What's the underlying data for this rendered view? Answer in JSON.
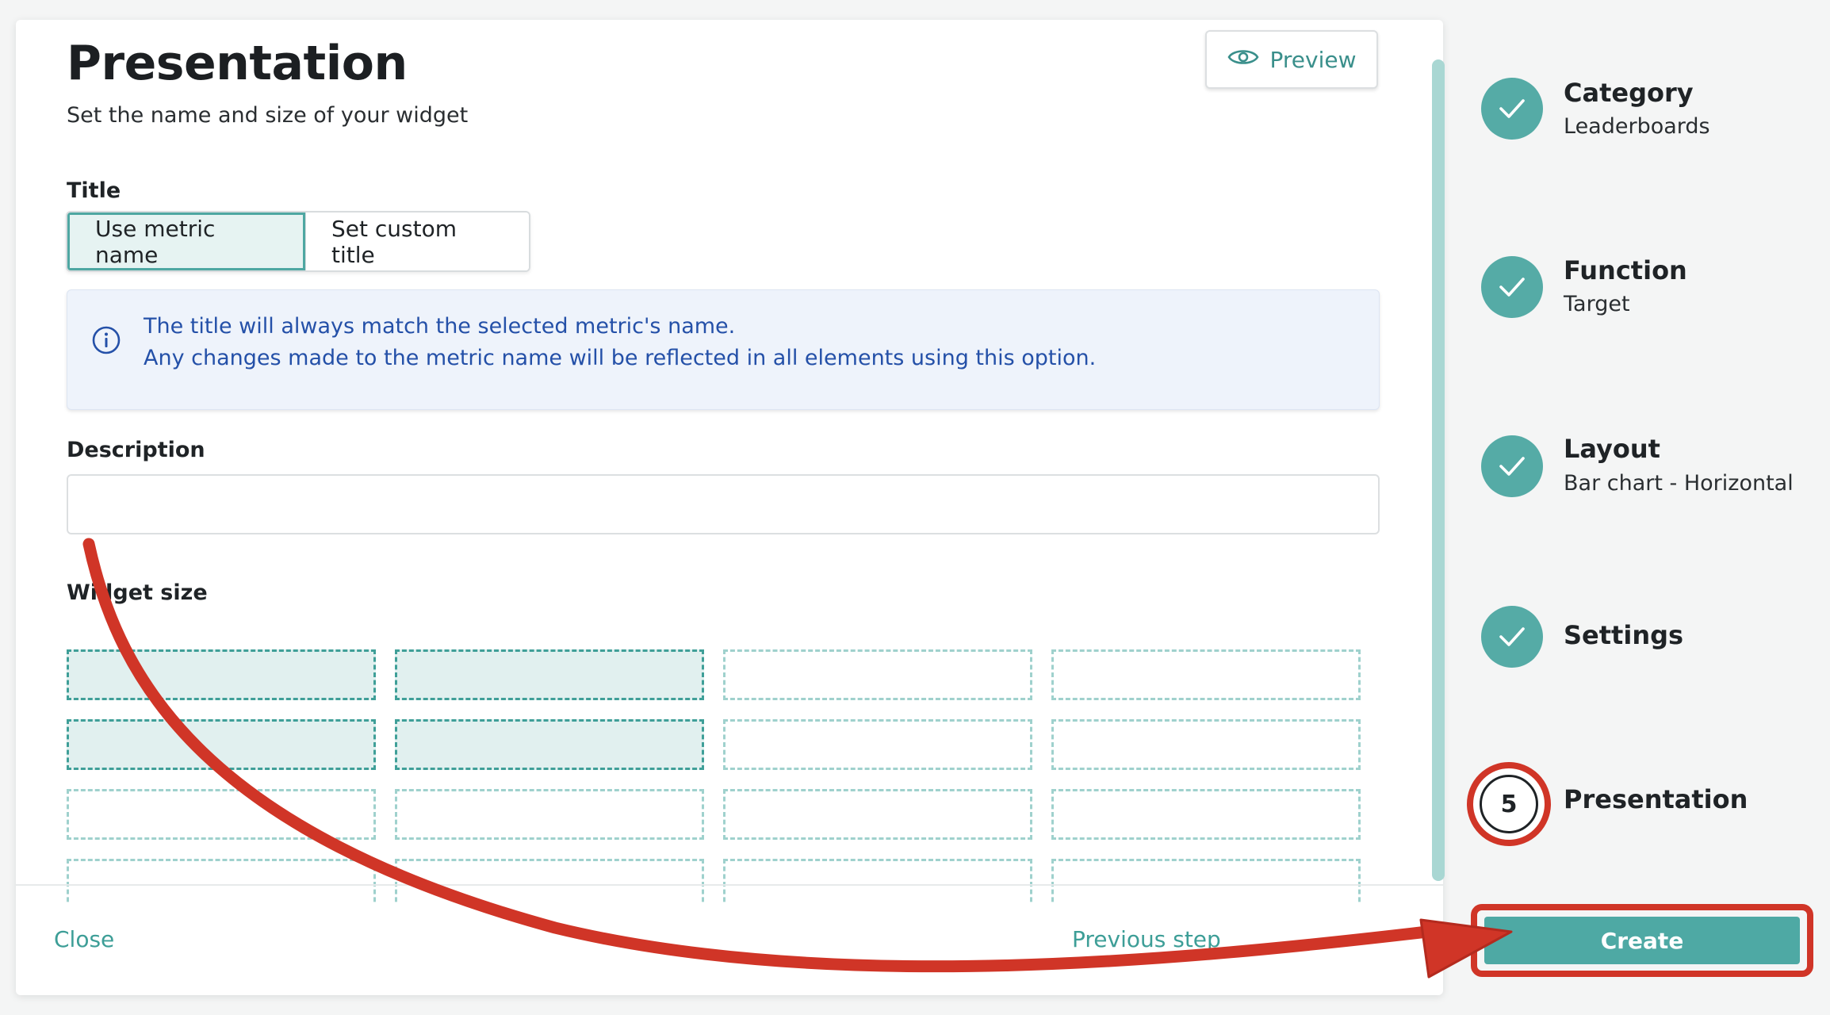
{
  "header": {
    "title": "Presentation",
    "subtitle": "Set the name and size of your widget",
    "preview_label": "Preview"
  },
  "title_section": {
    "label": "Title",
    "options": [
      "Use metric name",
      "Set custom title"
    ],
    "selected": "Use metric name"
  },
  "info": {
    "line1": "The title will always match the selected metric's name.",
    "line2": "Any changes made to the metric name will be reflected in all elements using this option."
  },
  "description": {
    "label": "Description",
    "value": "",
    "placeholder": ""
  },
  "widget_size": {
    "label": "Widget size",
    "columns": 4,
    "visible_rows": 4,
    "selected_columns": 2,
    "selected_rows": 2
  },
  "footer": {
    "close_label": "Close",
    "previous_label": "Previous step"
  },
  "stepper": {
    "steps": [
      {
        "title": "Category",
        "subtitle": "Leaderboards",
        "status": "done"
      },
      {
        "title": "Function",
        "subtitle": "Target",
        "status": "done"
      },
      {
        "title": "Layout",
        "subtitle": "Bar chart - Horizontal",
        "status": "done"
      },
      {
        "title": "Settings",
        "subtitle": "",
        "status": "done"
      },
      {
        "title": "Presentation",
        "subtitle": "",
        "status": "current",
        "number": "5"
      }
    ],
    "create_label": "Create"
  },
  "colors": {
    "accent": "#4ea9a4",
    "highlight": "#d03527",
    "info_text": "#2450a8",
    "info_bg": "#eef3fb"
  }
}
